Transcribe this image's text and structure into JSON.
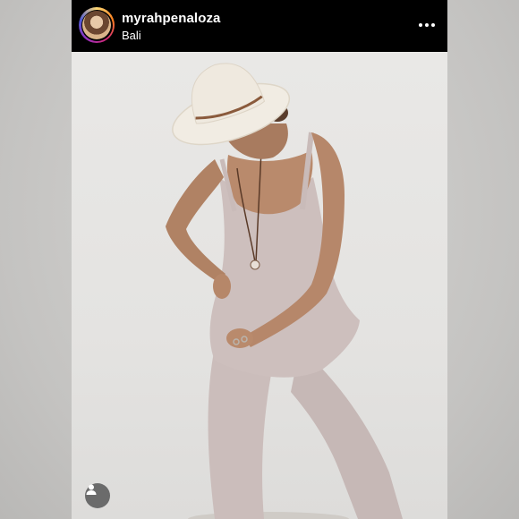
{
  "post": {
    "username": "myrahpenaloza",
    "location": "Bali"
  },
  "icons": {
    "more": "more-horizontal-icon",
    "user_tag": "user-tag-icon"
  },
  "colors": {
    "header_bg": "#000000",
    "header_text": "#ffffff",
    "story_ring": [
      "#feda75",
      "#fa7e1e",
      "#d62976",
      "#962fbf",
      "#4f5bd5"
    ]
  }
}
